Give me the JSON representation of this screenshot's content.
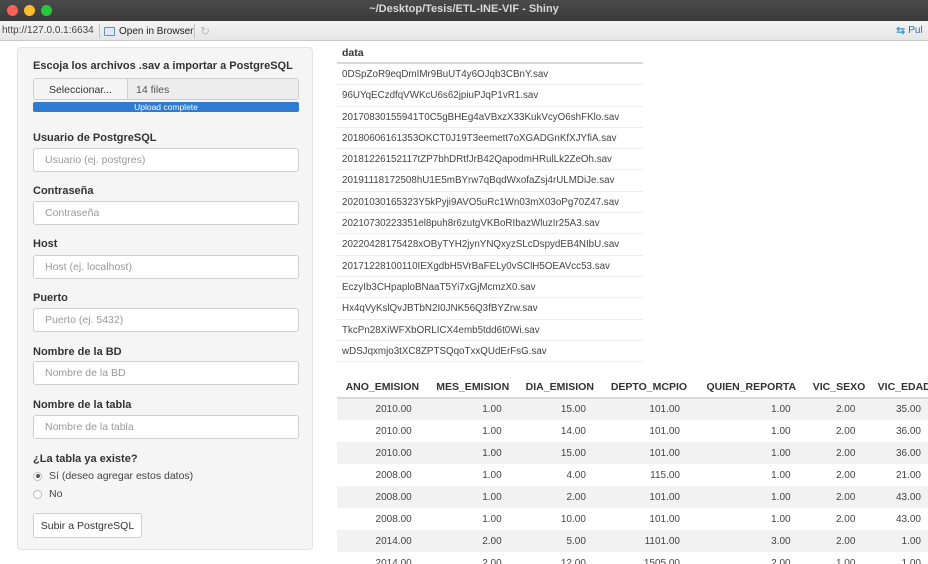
{
  "window": {
    "title": "~/Desktop/Tesis/ETL-INE-VIF - Shiny"
  },
  "toolbar": {
    "url": "http://127.0.0.1:6634",
    "open_in_browser": "Open in Browser",
    "publish": "Pul"
  },
  "sidebar": {
    "upload_label": "Escoja los archivos .sav a importar a PostgreSQL",
    "browse_button": "Seleccionar...",
    "file_count": "14 files",
    "upload_status": "Upload complete",
    "upload_progress": 1.0,
    "user_label": "Usuario de PostgreSQL",
    "user_placeholder": "Usuario (ej. postgres)",
    "password_label": "Contraseña",
    "password_placeholder": "Contraseña",
    "host_label": "Host",
    "host_placeholder": "Host (ej. localhost)",
    "port_label": "Puerto",
    "port_placeholder": "Puerto (ej. 5432)",
    "db_label": "Nombre de la BD",
    "db_placeholder": "Nombre de la BD",
    "table_label": "Nombre de la tabla",
    "table_placeholder": "Nombre de la tabla",
    "exists_label": "¿La tabla ya existe?",
    "option_yes": "Sí (deseo agregar estos datos)",
    "option_no": "No",
    "selected_option": "yes",
    "submit_button": "Subir a PostgreSQL"
  },
  "files_table": {
    "header": "data",
    "rows": [
      "0DSpZoR9eqDmIMr9BuUT4y6OJqb3CBnY.sav",
      "96UYqECzdfqVWKcU6s62jpiuPJqP1vR1.sav",
      "20170830155941T0C5gBHEg4aVBxzX33KukVcyO6shFKlo.sav",
      "20180606161353OKCT0J19T3eemett7oXGADGnKfXJYfiA.sav",
      "20181226152117tZP7bhDRtfJrB42QapodmHRulLk2ZeOh.sav",
      "20191118172508hU1E5mBYrw7qBqdWxofaZsj4rULMDiJe.sav",
      "20201030165323Y5kPyji9AVO5uRc1Wn03mX03oPg70Z47.sav",
      "20210730223351el8puh8r6zutgVKBoRIbazWluzIr25A3.sav",
      "20220428175428xOByTYH2jynYNQxyzSLcDspydEB4NIbU.sav",
      "20171228100110IEXgdbH5VrBaFELy0vSClH5OEAVcc53.sav",
      "EczyIb3CHpaploBNaaT5Yi7xGjMcmzX0.sav",
      "Hx4qVyKslQvJBTbN2I0JNK56Q3fBYZrw.sav",
      "TkcPn28XiWFXbORLICX4emb5tdd6t0Wi.sav",
      "wDSJqxmjo3tXC8ZPTSQqoTxxQUdErFsG.sav"
    ]
  },
  "data_table": {
    "columns": [
      "ANO_EMISION",
      "MES_EMISION",
      "DIA_EMISION",
      "DEPTO_MCPIO",
      "QUIEN_REPORTA",
      "VIC_SEXO",
      "VIC_EDAD"
    ],
    "rows": [
      [
        "2010.00",
        "1.00",
        "15.00",
        "101.00",
        "1.00",
        "2.00",
        "35.00"
      ],
      [
        "2010.00",
        "1.00",
        "14.00",
        "101.00",
        "1.00",
        "2.00",
        "36.00"
      ],
      [
        "2010.00",
        "1.00",
        "15.00",
        "101.00",
        "1.00",
        "2.00",
        "36.00"
      ],
      [
        "2008.00",
        "1.00",
        "4.00",
        "115.00",
        "1.00",
        "2.00",
        "21.00"
      ],
      [
        "2008.00",
        "1.00",
        "2.00",
        "101.00",
        "1.00",
        "2.00",
        "43.00"
      ],
      [
        "2008.00",
        "1.00",
        "10.00",
        "101.00",
        "1.00",
        "2.00",
        "43.00"
      ],
      [
        "2014.00",
        "2.00",
        "5.00",
        "1101.00",
        "3.00",
        "2.00",
        "1.00"
      ],
      [
        "2014.00",
        "2.00",
        "12.00",
        "1505.00",
        "2.00",
        "1.00",
        "1.00"
      ]
    ]
  }
}
